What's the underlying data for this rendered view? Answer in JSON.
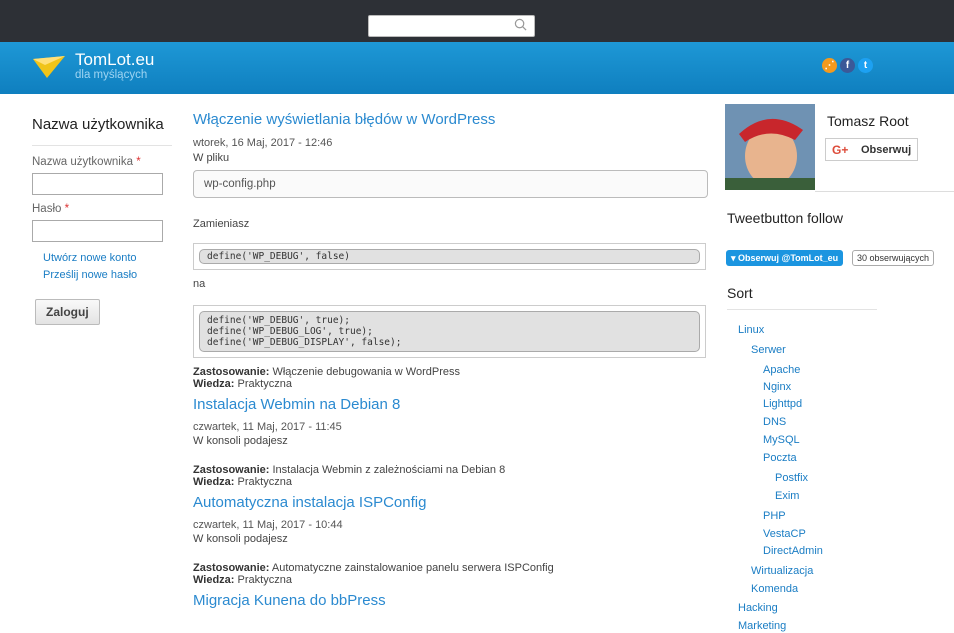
{
  "header": {
    "site_name": "TomLot.eu",
    "slogan": "dla myślących"
  },
  "search": {
    "placeholder": ""
  },
  "login": {
    "title": "Nazwa użytkownika",
    "username_label": "Nazwa użytkownika",
    "password_label": "Hasło",
    "required_mark": "*",
    "links": [
      "Utwórz nowe konto",
      "Prześlij nowe hasło"
    ],
    "submit": "Zaloguj"
  },
  "posts": [
    {
      "title": "Włączenie wyświetlania błędów w WordPress",
      "date": "wtorek, 16 Maj, 2017 - 12:46",
      "intro": "W pliku",
      "file": "wp-config.php",
      "replace_text": "Zamieniasz",
      "code1": "define('WP_DEBUG', false)",
      "na": "na",
      "code2": "define('WP_DEBUG', true);\ndefine('WP_DEBUG_LOG', true);\ndefine('WP_DEBUG_DISPLAY', false);",
      "zast_label": "Zastosowanie:",
      "zast": "Włączenie debugowania w WordPress",
      "wiedza_label": "Wiedza:",
      "wiedza": "Praktyczna"
    },
    {
      "title": "Instalacja Webmin na Debian 8",
      "date": "czwartek, 11 Maj, 2017 - 11:45",
      "intro": "W konsoli podajesz",
      "zast_label": "Zastosowanie:",
      "zast": "Instalacja Webmin z zależnościami na Debian 8",
      "wiedza_label": "Wiedza:",
      "wiedza": "Praktyczna"
    },
    {
      "title": "Automatyczna instalacja ISPConfig",
      "date": "czwartek, 11 Maj, 2017 - 10:44",
      "intro": "W konsoli podajesz",
      "zast_label": "Zastosowanie:",
      "zast": "Automatyczne zainstalowanioe panelu serwera ISPConfig",
      "wiedza_label": "Wiedza:",
      "wiedza": "Praktyczna"
    },
    {
      "title": "Migracja Kunena do bbPress"
    }
  ],
  "profile": {
    "name": "Tomasz Root",
    "gplus_icon": "G+",
    "follow": "Obserwuj"
  },
  "tweet": {
    "heading": "Tweetbutton follow",
    "button": "Obserwuj @TomLot_eu",
    "count": "30 obserwujących"
  },
  "sort": {
    "heading": "Sort",
    "items": [
      "Linux",
      "Serwer",
      "Apache",
      "Nginx",
      "Lighttpd",
      "DNS",
      "MySQL",
      "Poczta",
      "Postfix",
      "Exim",
      "PHP",
      "VestaCP",
      "DirectAdmin",
      "Wirtualizacja",
      "Komenda",
      "Hacking",
      "Marketing"
    ]
  },
  "colors": {
    "accent": "#1e98d6",
    "link": "#1a7dc4",
    "topbar": "#2d3036"
  },
  "icons": [
    "search-icon",
    "logo-icon",
    "rss-icon",
    "facebook-icon",
    "twitter-icon",
    "twitter-bird-icon"
  ]
}
